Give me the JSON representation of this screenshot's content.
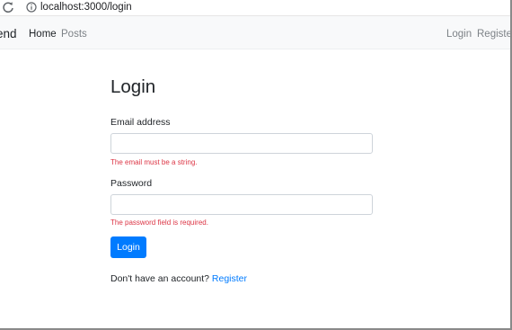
{
  "browser": {
    "url": "localhost:3000/login",
    "reload_icon": "reload-icon",
    "info_icon": "info-icon"
  },
  "navbar": {
    "brand": "end",
    "home": "Home",
    "posts": "Posts",
    "login": "Login",
    "register": "Register"
  },
  "form": {
    "title": "Login",
    "email_label": "Email address",
    "email_value": "",
    "email_error": "The email must be a string.",
    "password_label": "Password",
    "password_value": "",
    "password_error": "The password field is required.",
    "submit_label": "Login"
  },
  "footer": {
    "prompt": "Don't have an account?",
    "register_link": "Register"
  },
  "colors": {
    "primary": "#007bff",
    "danger": "#dc3545",
    "navbar_bg": "#f8f9fa"
  }
}
